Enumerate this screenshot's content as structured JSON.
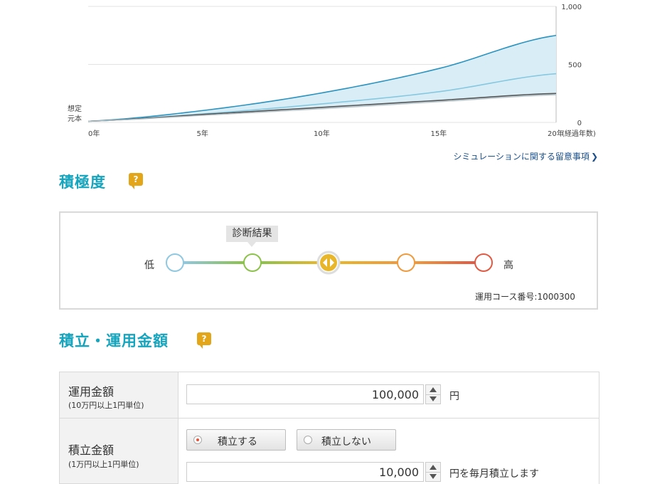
{
  "chart": {
    "y_tick_labels": [
      "1,000",
      "500",
      "0"
    ],
    "x_tick_labels": [
      "0年",
      "5年",
      "10年",
      "15年",
      "20年"
    ],
    "x_unit_label": "(経過年数)",
    "principal_label_line1": "想定",
    "principal_label_line2": "元本",
    "colors": {
      "upper": "#2b93bf",
      "expected": "#86c8e0",
      "principal": "#555555",
      "lower": "#b8c3c8",
      "band_fill": "#d8edf6",
      "grid": "#e3e3e3"
    }
  },
  "chart_data": {
    "type": "area",
    "x": [
      0,
      5,
      10,
      15,
      20
    ],
    "ylim": [
      0,
      1000
    ],
    "x_tick_labels": [
      "0年",
      "5年",
      "10年",
      "15年",
      "20年"
    ],
    "xlabel": "(経過年数)",
    "y_tick_labels": [
      "1,000",
      "500",
      "0"
    ],
    "series": [
      {
        "values": [
          10,
          105,
          255,
          465,
          750
        ]
      },
      {
        "values": [
          10,
          75,
          160,
          265,
          420
        ]
      },
      {
        "values": [
          10,
          70,
          130,
          190,
          250
        ]
      },
      {
        "values": [
          10,
          62,
          118,
          178,
          238
        ]
      }
    ],
    "grid": true
  },
  "notice_link": {
    "label": "シミュレーションに関する留意事項",
    "chevron": "❯"
  },
  "risk_section": {
    "title": "積極度",
    "help_label": "?",
    "low_label": "低",
    "high_label": "高",
    "diagnosis_tooltip": "診断結果",
    "diagnosis_level": 2,
    "selected_level": 3,
    "levels": 5,
    "level_colors": [
      "#8fc8e0",
      "#8cc24a",
      "#e8b62a",
      "#ef9a3c",
      "#e05a44"
    ],
    "course_number": "運用コース番号:1000300"
  },
  "amount_section": {
    "title": "積立・運用金額",
    "help_label": "?",
    "investment": {
      "label": "運用金額",
      "sublabel": "(10万円以上1円単位)",
      "value": "100,000",
      "unit": "円"
    },
    "monthly": {
      "label": "積立金額",
      "sublabel": "(1万円以上1円単位)",
      "option_yes": "積立する",
      "option_no": "積立しない",
      "selected": "yes",
      "value": "10,000",
      "unit": "円を毎月積立します"
    }
  }
}
